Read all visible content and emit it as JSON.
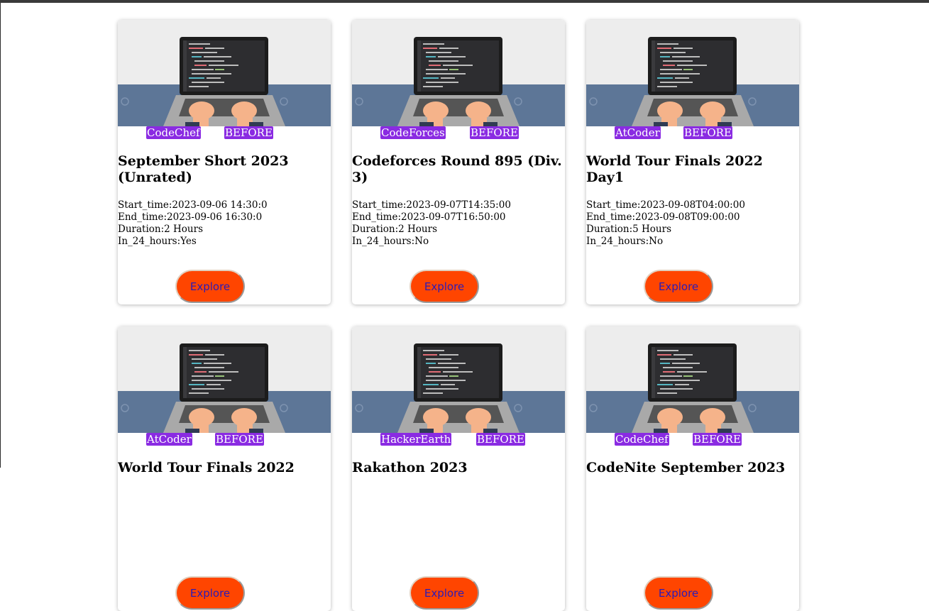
{
  "colors": {
    "tag_bg": "#8a2be2",
    "button_bg": "#ff4500",
    "button_text": "#2b1bb8"
  },
  "contests": [
    {
      "platform": "CodeChef",
      "status": "BEFORE",
      "title": "September Short 2023 (Unrated)",
      "start": "Start_time:2023-09-06 14:30:0",
      "end": "End_time:2023-09-06 16:30:0",
      "duration": "Duration:2 Hours",
      "in24": "In_24_hours:Yes",
      "button": "Explore"
    },
    {
      "platform": "CodeForces",
      "status": "BEFORE",
      "title": "Codeforces Round 895 (Div. 3)",
      "start": "Start_time:2023-09-07T14:35:00",
      "end": "End_time:2023-09-07T16:50:00",
      "duration": "Duration:2 Hours",
      "in24": "In_24_hours:No",
      "button": "Explore"
    },
    {
      "platform": "AtCoder",
      "status": "BEFORE",
      "title": "World Tour Finals 2022 Day1",
      "start": "Start_time:2023-09-08T04:00:00",
      "end": "End_time:2023-09-08T09:00:00",
      "duration": "Duration:5 Hours",
      "in24": "In_24_hours:No",
      "button": "Explore"
    },
    {
      "platform": "AtCoder",
      "status": "BEFORE",
      "title": "World Tour Finals 2022",
      "start": "",
      "end": "",
      "duration": "",
      "in24": "",
      "button": "Explore"
    },
    {
      "platform": "HackerEarth",
      "status": "BEFORE",
      "title": "Rakathon 2023",
      "start": "",
      "end": "",
      "duration": "",
      "in24": "",
      "button": "Explore"
    },
    {
      "platform": "CodeChef",
      "status": "BEFORE",
      "title": "CodeNite September 2023",
      "start": "",
      "end": "",
      "duration": "",
      "in24": "",
      "button": "Explore"
    }
  ]
}
